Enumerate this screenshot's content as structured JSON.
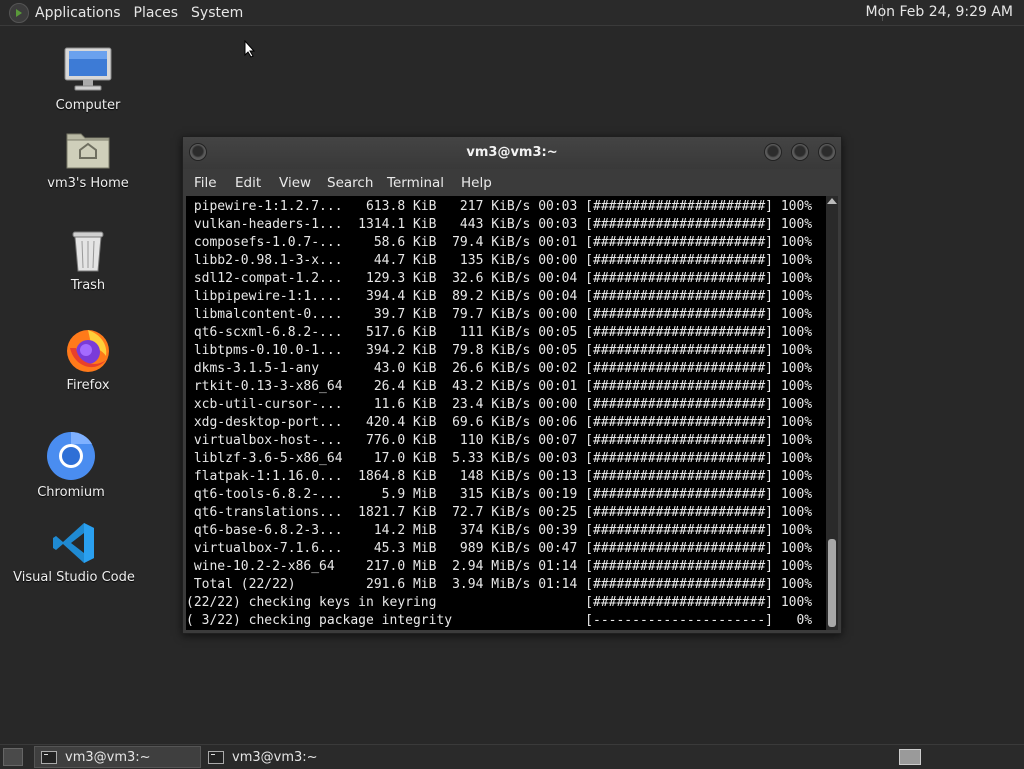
{
  "top_panel": {
    "menus": [
      "Applications",
      "Places",
      "System"
    ],
    "clock": "Mon Feb 24,  9:29 AM"
  },
  "desktop_icons": [
    {
      "label": "Computer",
      "icon": "computer-icon"
    },
    {
      "label": "vm3's Home",
      "icon": "home-folder-icon"
    },
    {
      "label": "Trash",
      "icon": "trash-icon"
    },
    {
      "label": "Firefox",
      "icon": "firefox-icon"
    },
    {
      "label": "Chromium",
      "icon": "chromium-icon"
    },
    {
      "label": "Visual Studio Code",
      "icon": "vscode-icon"
    }
  ],
  "terminal": {
    "title": "vm3@vm3:~",
    "menu": [
      "File",
      "Edit",
      "View",
      "Search",
      "Terminal",
      "Help"
    ],
    "lines": [
      " pipewire-1:1.2.7...   613.8 KiB   217 KiB/s 00:03 [######################] 100%",
      " vulkan-headers-1...  1314.1 KiB   443 KiB/s 00:03 [######################] 100%",
      " composefs-1.0.7-...    58.6 KiB  79.4 KiB/s 00:01 [######################] 100%",
      " libb2-0.98.1-3-x...    44.7 KiB   135 KiB/s 00:00 [######################] 100%",
      " sdl12-compat-1.2...   129.3 KiB  32.6 KiB/s 00:04 [######################] 100%",
      " libpipewire-1:1....   394.4 KiB  89.2 KiB/s 00:04 [######################] 100%",
      " libmalcontent-0....    39.7 KiB  79.7 KiB/s 00:00 [######################] 100%",
      " qt6-scxml-6.8.2-...   517.6 KiB   111 KiB/s 00:05 [######################] 100%",
      " libtpms-0.10.0-1...   394.2 KiB  79.8 KiB/s 00:05 [######################] 100%",
      " dkms-3.1.5-1-any       43.0 KiB  26.6 KiB/s 00:02 [######################] 100%",
      " rtkit-0.13-3-x86_64    26.4 KiB  43.2 KiB/s 00:01 [######################] 100%",
      " xcb-util-cursor-...    11.6 KiB  23.4 KiB/s 00:00 [######################] 100%",
      " xdg-desktop-port...   420.4 KiB  69.6 KiB/s 00:06 [######################] 100%",
      " virtualbox-host-...   776.0 KiB   110 KiB/s 00:07 [######################] 100%",
      " liblzf-3.6-5-x86_64    17.0 KiB  5.33 KiB/s 00:03 [######################] 100%",
      " flatpak-1:1.16.0...  1864.8 KiB   148 KiB/s 00:13 [######################] 100%",
      " qt6-tools-6.8.2-...     5.9 MiB   315 KiB/s 00:19 [######################] 100%",
      " qt6-translations...  1821.7 KiB  72.7 KiB/s 00:25 [######################] 100%",
      " qt6-base-6.8.2-3...    14.2 MiB   374 KiB/s 00:39 [######################] 100%",
      " virtualbox-7.1.6...    45.3 MiB   989 KiB/s 00:47 [######################] 100%",
      " wine-10.2-2-x86_64    217.0 MiB  2.94 MiB/s 01:14 [######################] 100%",
      " Total (22/22)         291.6 MiB  3.94 MiB/s 01:14 [######################] 100%",
      "(22/22) checking keys in keyring                   [######################] 100%",
      "( 3/22) checking package integrity                 [----------------------]   0%"
    ]
  },
  "taskbar": {
    "tasks": [
      "vm3@vm3:~",
      "vm3@vm3:~"
    ]
  }
}
